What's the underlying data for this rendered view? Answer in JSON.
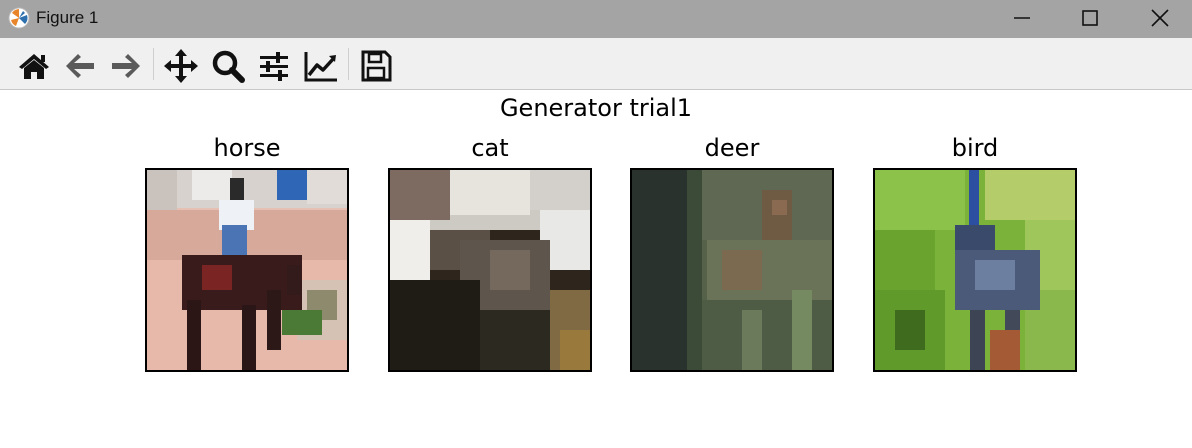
{
  "window": {
    "title": "Figure 1"
  },
  "toolbar": {
    "buttons": [
      "home-icon",
      "back-icon",
      "forward-icon",
      "pan-icon",
      "zoom-icon",
      "configure-subplots-icon",
      "edit-axes-icon",
      "save-icon"
    ]
  },
  "figure": {
    "suptitle": "Generator trial1",
    "subplots": [
      {
        "title": "horse"
      },
      {
        "title": "cat"
      },
      {
        "title": "deer"
      },
      {
        "title": "bird"
      }
    ]
  }
}
